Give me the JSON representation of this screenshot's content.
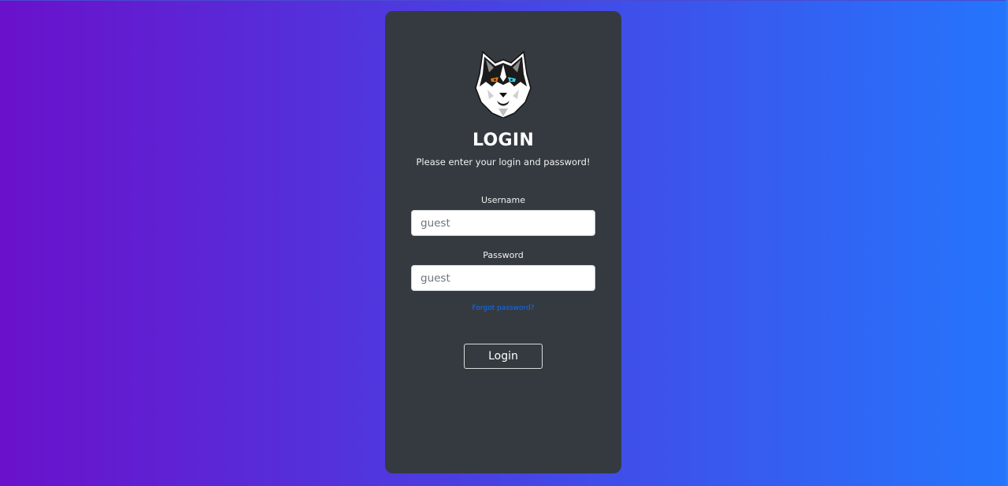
{
  "colors": {
    "gradient_start": "#6a11cb",
    "gradient_end": "#2575fc",
    "card_background": "#343a40",
    "link": "#0d6efd"
  },
  "login_card": {
    "logo_icon": "husky-wolf-head-icon",
    "title": "LOGIN",
    "subtitle": "Please enter your login and password!",
    "username": {
      "label": "Username",
      "placeholder": "guest",
      "value": ""
    },
    "password": {
      "label": "Password",
      "placeholder": "guest",
      "value": ""
    },
    "forgot_password_link": "Forgot password?",
    "submit_label": "Login"
  }
}
